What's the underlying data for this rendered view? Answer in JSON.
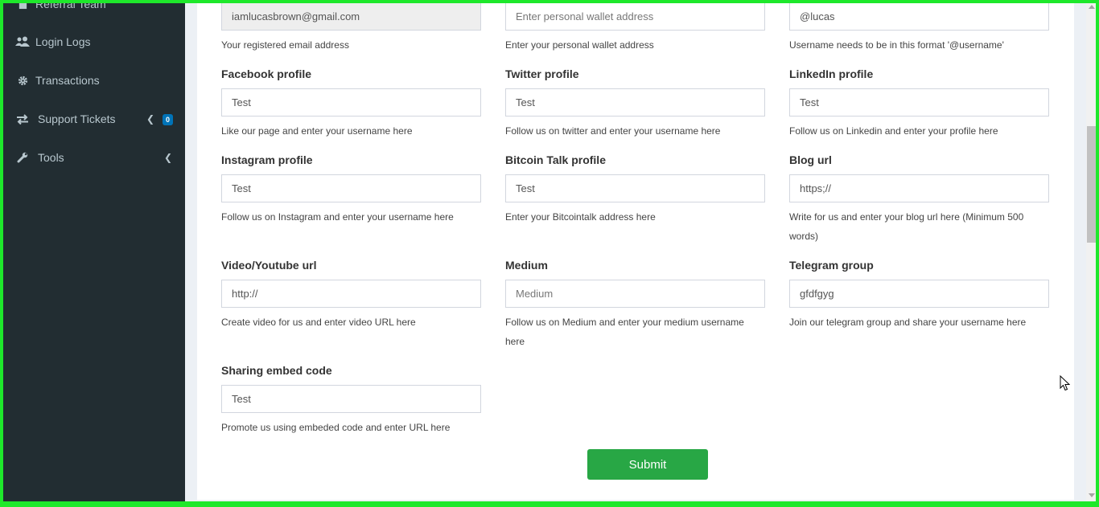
{
  "sidebar": {
    "items": [
      {
        "label": "Referral Team",
        "icon": "user-icon"
      },
      {
        "label": "Login Logs",
        "icon": "users-icon"
      },
      {
        "label": "Transactions",
        "icon": "gear-icon"
      },
      {
        "label": "Support Tickets",
        "icon": "exchange-icon",
        "badge": "0"
      },
      {
        "label": "Tools",
        "icon": "wrench-icon"
      }
    ]
  },
  "form": {
    "email": {
      "value": "iamlucasbrown@gmail.com",
      "help": "Your registered email address"
    },
    "wallet": {
      "placeholder": "Enter personal wallet address",
      "help": "Enter your personal wallet address"
    },
    "username": {
      "value": "@lucas",
      "help": "Username needs to be in this format '@username'"
    },
    "facebook": {
      "label": "Facebook profile",
      "value": "Test",
      "help": "Like our page and enter your username here"
    },
    "twitter": {
      "label": "Twitter profile",
      "value": "Test",
      "help": "Follow us on twitter and enter your username here"
    },
    "linkedin": {
      "label": "LinkedIn profile",
      "value": "Test",
      "help": "Follow us on Linkedin and enter your profile here"
    },
    "instagram": {
      "label": "Instagram profile",
      "value": "Test",
      "help": "Follow us on Instagram and enter your username here"
    },
    "bitcointalk": {
      "label": "Bitcoin Talk profile",
      "value": "Test",
      "help": "Enter your Bitcointalk address here"
    },
    "blog": {
      "label": "Blog url",
      "value": "https;//",
      "help": "Write for us and enter your blog url here (Minimum 500 words)"
    },
    "video": {
      "label": "Video/Youtube url",
      "value": "http://",
      "help": "Create video for us and enter video URL here"
    },
    "medium": {
      "label": "Medium",
      "placeholder": "Medium",
      "help": "Follow us on Medium and enter your medium username here"
    },
    "telegram": {
      "label": "Telegram group",
      "value": "gfdfgyg",
      "help": "Join our telegram group and share your username here"
    },
    "embed": {
      "label": "Sharing embed code",
      "value": "Test",
      "help": "Promote us using embeded code and enter URL here"
    },
    "submit_label": "Submit"
  },
  "colors": {
    "sidebar_bg": "#222d32",
    "submit": "#28a745",
    "frame": "#1ee82b",
    "badge": "#0073b7"
  }
}
